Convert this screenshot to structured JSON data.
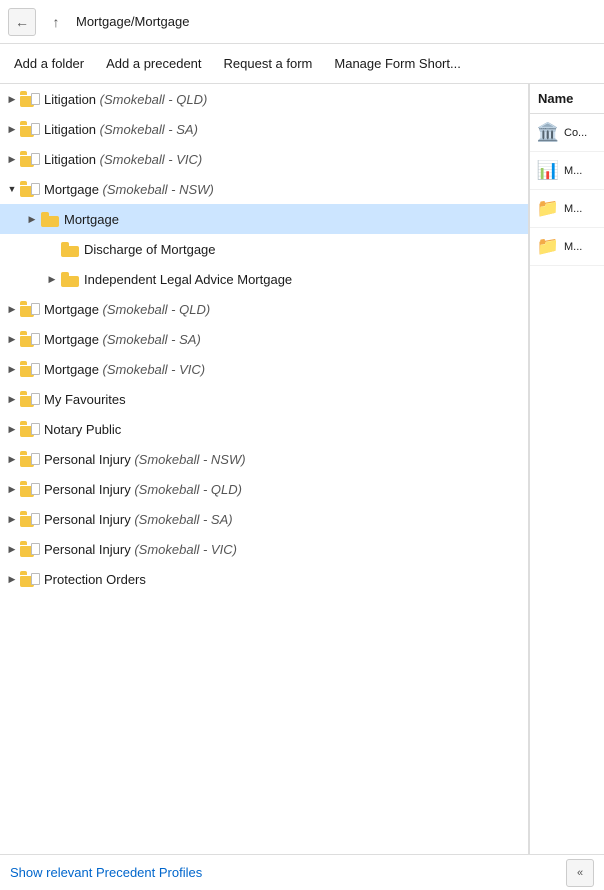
{
  "nav": {
    "back_label": "←",
    "up_label": "↑",
    "path": "Mortgage/Mortgage"
  },
  "toolbar": {
    "add_folder_label": "Add a folder",
    "add_precedent_label": "Add a precedent",
    "request_form_label": "Request a form",
    "manage_form_short_label": "Manage Form Short..."
  },
  "tree": {
    "items": [
      {
        "id": "lit-qld",
        "indent": 0,
        "expandable": true,
        "expanded": false,
        "folder_type": "doc",
        "label": "Litigation",
        "italic": "(Smokeball - QLD)"
      },
      {
        "id": "lit-sa",
        "indent": 0,
        "expandable": true,
        "expanded": false,
        "folder_type": "doc",
        "label": "Litigation",
        "italic": "(Smokeball - SA)"
      },
      {
        "id": "lit-vic",
        "indent": 0,
        "expandable": true,
        "expanded": false,
        "folder_type": "doc",
        "label": "Litigation",
        "italic": "(Smokeball - VIC)"
      },
      {
        "id": "mortgage-nsw",
        "indent": 0,
        "expandable": true,
        "expanded": true,
        "folder_type": "doc",
        "label": "Mortgage",
        "italic": "(Smokeball - NSW)"
      },
      {
        "id": "mortgage-main",
        "indent": 1,
        "expandable": true,
        "expanded": false,
        "folder_type": "plain",
        "label": "Mortgage",
        "italic": "",
        "selected": true
      },
      {
        "id": "discharge",
        "indent": 2,
        "expandable": false,
        "expanded": false,
        "folder_type": "plain",
        "label": "Discharge of Mortgage",
        "italic": ""
      },
      {
        "id": "ila",
        "indent": 2,
        "expandable": true,
        "expanded": false,
        "folder_type": "plain",
        "label": "Independent Legal Advice Mortgage",
        "italic": ""
      },
      {
        "id": "mortgage-qld",
        "indent": 0,
        "expandable": true,
        "expanded": false,
        "folder_type": "doc",
        "label": "Mortgage",
        "italic": "(Smokeball - QLD)"
      },
      {
        "id": "mortgage-sa",
        "indent": 0,
        "expandable": true,
        "expanded": false,
        "folder_type": "doc",
        "label": "Mortgage",
        "italic": "(Smokeball - SA)"
      },
      {
        "id": "mortgage-vic",
        "indent": 0,
        "expandable": true,
        "expanded": false,
        "folder_type": "doc",
        "label": "Mortgage",
        "italic": "(Smokeball - VIC)"
      },
      {
        "id": "my-fav",
        "indent": 0,
        "expandable": true,
        "expanded": false,
        "folder_type": "doc",
        "label": "My Favourites",
        "italic": ""
      },
      {
        "id": "notary",
        "indent": 0,
        "expandable": true,
        "expanded": false,
        "folder_type": "doc",
        "label": "Notary Public",
        "italic": ""
      },
      {
        "id": "pi-nsw",
        "indent": 0,
        "expandable": true,
        "expanded": false,
        "folder_type": "doc",
        "label": "Personal Injury",
        "italic": "(Smokeball - NSW)"
      },
      {
        "id": "pi-qld",
        "indent": 0,
        "expandable": true,
        "expanded": false,
        "folder_type": "doc",
        "label": "Personal Injury",
        "italic": "(Smokeball - QLD)"
      },
      {
        "id": "pi-sa",
        "indent": 0,
        "expandable": true,
        "expanded": false,
        "folder_type": "doc",
        "label": "Personal Injury",
        "italic": "(Smokeball - SA)"
      },
      {
        "id": "pi-vic",
        "indent": 0,
        "expandable": true,
        "expanded": false,
        "folder_type": "doc",
        "label": "Personal Injury",
        "italic": "(Smokeball - VIC)"
      },
      {
        "id": "protection",
        "indent": 0,
        "expandable": true,
        "expanded": false,
        "folder_type": "doc",
        "label": "Protection Orders",
        "italic": ""
      }
    ]
  },
  "right_panel": {
    "header": "Name",
    "items": [
      {
        "id": "rp1",
        "icon": "🏛️",
        "text": "Co..."
      },
      {
        "id": "rp2",
        "icon": "📊",
        "text": "M..."
      },
      {
        "id": "rp3",
        "icon": "📁",
        "text": "M..."
      },
      {
        "id": "rp4",
        "icon": "📁",
        "text": "M..."
      }
    ]
  },
  "bottom": {
    "show_relevant_label": "Show relevant Precedent Profiles",
    "collapse_label": "«"
  },
  "colors": {
    "selected_bg": "#cce5ff",
    "hover_bg": "#e8f4fd",
    "link_color": "#0066cc",
    "folder_yellow": "#f5c542"
  }
}
